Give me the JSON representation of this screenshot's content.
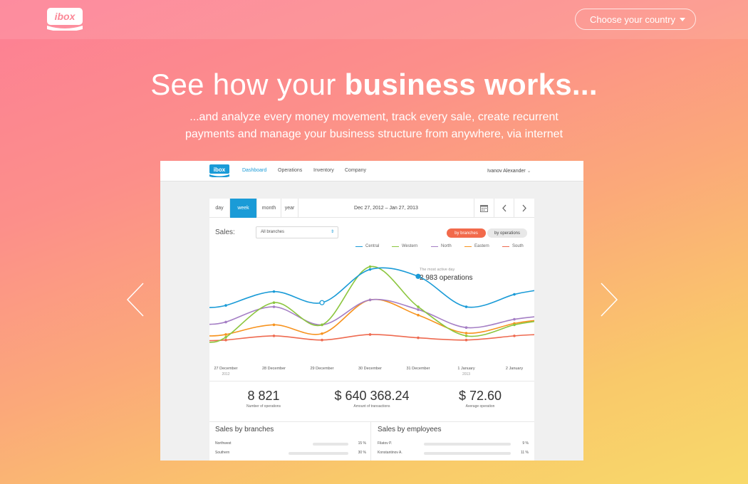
{
  "brand": {
    "logo_text": "ibox"
  },
  "header": {
    "country_label": "Choose your country"
  },
  "hero": {
    "title_light": "See how your ",
    "title_bold": "business works...",
    "subtitle_line1": "...and analyze every money movement, track every sale, create recurrent",
    "subtitle_line2": "payments and manage your business structure from anywhere, via internet"
  },
  "screenshot": {
    "nav": {
      "logo_text": "ibox",
      "items": [
        "Dashboard",
        "Operations",
        "Inventory",
        "Company"
      ],
      "user": "Ivanov Alexander"
    },
    "period_tabs": [
      "day",
      "week",
      "month",
      "year"
    ],
    "active_period": "week",
    "date_range": "Dec 27, 2012 – Jan 27, 2013",
    "sales_label": "Sales:",
    "branch_select": "All branches",
    "toggle": {
      "on": "by branches",
      "off": "by operations"
    },
    "callout": {
      "caption": "The most active day",
      "value": "2 983 operations"
    },
    "stats": [
      {
        "value": "8 821",
        "label": "Number of operations"
      },
      {
        "value": "$ 640 368.24",
        "label": "Amount of transactions"
      },
      {
        "value": "$ 72.60",
        "label": "Average operation"
      }
    ],
    "branches_table": {
      "title": "Sales by branches",
      "rows": [
        {
          "name": "Northwest",
          "pct": "15 %"
        },
        {
          "name": "Southern",
          "pct": "30 %"
        }
      ]
    },
    "employees_table": {
      "title": "Sales by employees",
      "rows": [
        {
          "name": "Filatov P.",
          "pct": "9 %"
        },
        {
          "name": "Konstantinov A.",
          "pct": "11 %"
        }
      ]
    }
  },
  "chart_data": {
    "type": "line",
    "x": [
      "27 December",
      "28 December",
      "29 December",
      "30 December",
      "31 December",
      "1 January",
      "2 January"
    ],
    "x_sublabels": [
      "2012",
      "",
      "",
      "",
      "",
      "2013",
      ""
    ],
    "ylim": [
      0,
      3600
    ],
    "grid": false,
    "legend_position": "top-right",
    "series": [
      {
        "name": "Central",
        "color": "#1a9bd7",
        "values": [
          1900,
          2400,
          2000,
          3200,
          2950,
          1850,
          2300
        ]
      },
      {
        "name": "Western",
        "color": "#8cc63f",
        "values": [
          750,
          2000,
          1200,
          3300,
          1850,
          800,
          1200
        ]
      },
      {
        "name": "North",
        "color": "#a57fc5",
        "values": [
          1300,
          1850,
          1200,
          2100,
          1750,
          1100,
          1400
        ]
      },
      {
        "name": "Eastern",
        "color": "#f7931e",
        "values": [
          850,
          1200,
          880,
          2100,
          1550,
          900,
          1250
        ]
      },
      {
        "name": "South",
        "color": "#ee6a50",
        "values": [
          650,
          800,
          650,
          850,
          730,
          650,
          800
        ]
      }
    ]
  },
  "colors": {
    "accent": "#1a9bd7",
    "toggle_on": "#f26a4b"
  },
  "icons": {
    "left": "chevron-left-icon",
    "right": "chevron-right-icon",
    "calendar": "calendar-icon"
  }
}
